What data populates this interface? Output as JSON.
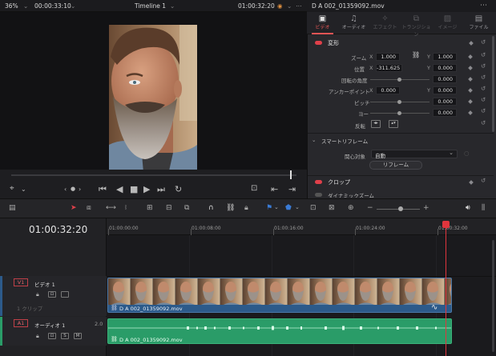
{
  "viewer": {
    "zoom": "36%",
    "timecode_left": "00:00:33:10",
    "timeline_name": "Timeline 1",
    "timecode_right": "01:00:32:20"
  },
  "inspector": {
    "clip_name": "D A 002_01359092.mov",
    "tabs": [
      {
        "label": "ビデオ",
        "icon": "video-icon"
      },
      {
        "label": "オーディオ",
        "icon": "music-note-icon"
      },
      {
        "label": "エフェクト",
        "icon": "effects-icon"
      },
      {
        "label": "トランジション",
        "icon": "transition-icon"
      },
      {
        "label": "イメージ",
        "icon": "image-icon"
      },
      {
        "label": "ファイル",
        "icon": "file-icon"
      }
    ],
    "transform": {
      "title": "変形",
      "zoom_label": "ズーム",
      "zoom_x": "1.000",
      "zoom_y": "1.000",
      "position_label": "位置",
      "position_x": "-311.625",
      "position_y": "0.000",
      "rotation_label": "回転の角度",
      "rotation_value": "0.000",
      "anchor_label": "アンカーポイント",
      "anchor_x": "0.000",
      "anchor_y": "0.000",
      "pitch_label": "ピッチ",
      "pitch_value": "0.000",
      "yaw_label": "ヨー",
      "yaw_value": "0.000",
      "flip_label": "反転",
      "x_letter": "X",
      "y_letter": "Y"
    },
    "smart_reframe": {
      "title": "スマートリフレーム",
      "object_label": "関心対象",
      "object_value": "自動",
      "button_label": "リフレーム"
    },
    "crop": {
      "title": "クロップ"
    },
    "dynamic_zoom": {
      "title": "ダイナミックズーム"
    }
  },
  "timeline": {
    "timecode": "01:00:32:20",
    "ruler": [
      "01:00:00:00",
      "01:00:08:00",
      "01:00:16:00",
      "01:00:24:00",
      "01:00:32:00"
    ],
    "video_track": {
      "id": "V1",
      "name": "ビデオ 1",
      "clip_count": "1 クリップ"
    },
    "audio_track": {
      "id": "A1",
      "name": "オーディオ 1",
      "level": "2.0",
      "solo": "S",
      "mute": "M"
    },
    "video_clip_name": "D A 002_01359092.mov",
    "audio_clip_name": "D A 002_01359092.mov"
  },
  "colors": {
    "accent_red": "#e05454",
    "video_clip": "#2c5a8a",
    "audio_clip": "#2a9c68",
    "playhead": "#e0353d"
  }
}
